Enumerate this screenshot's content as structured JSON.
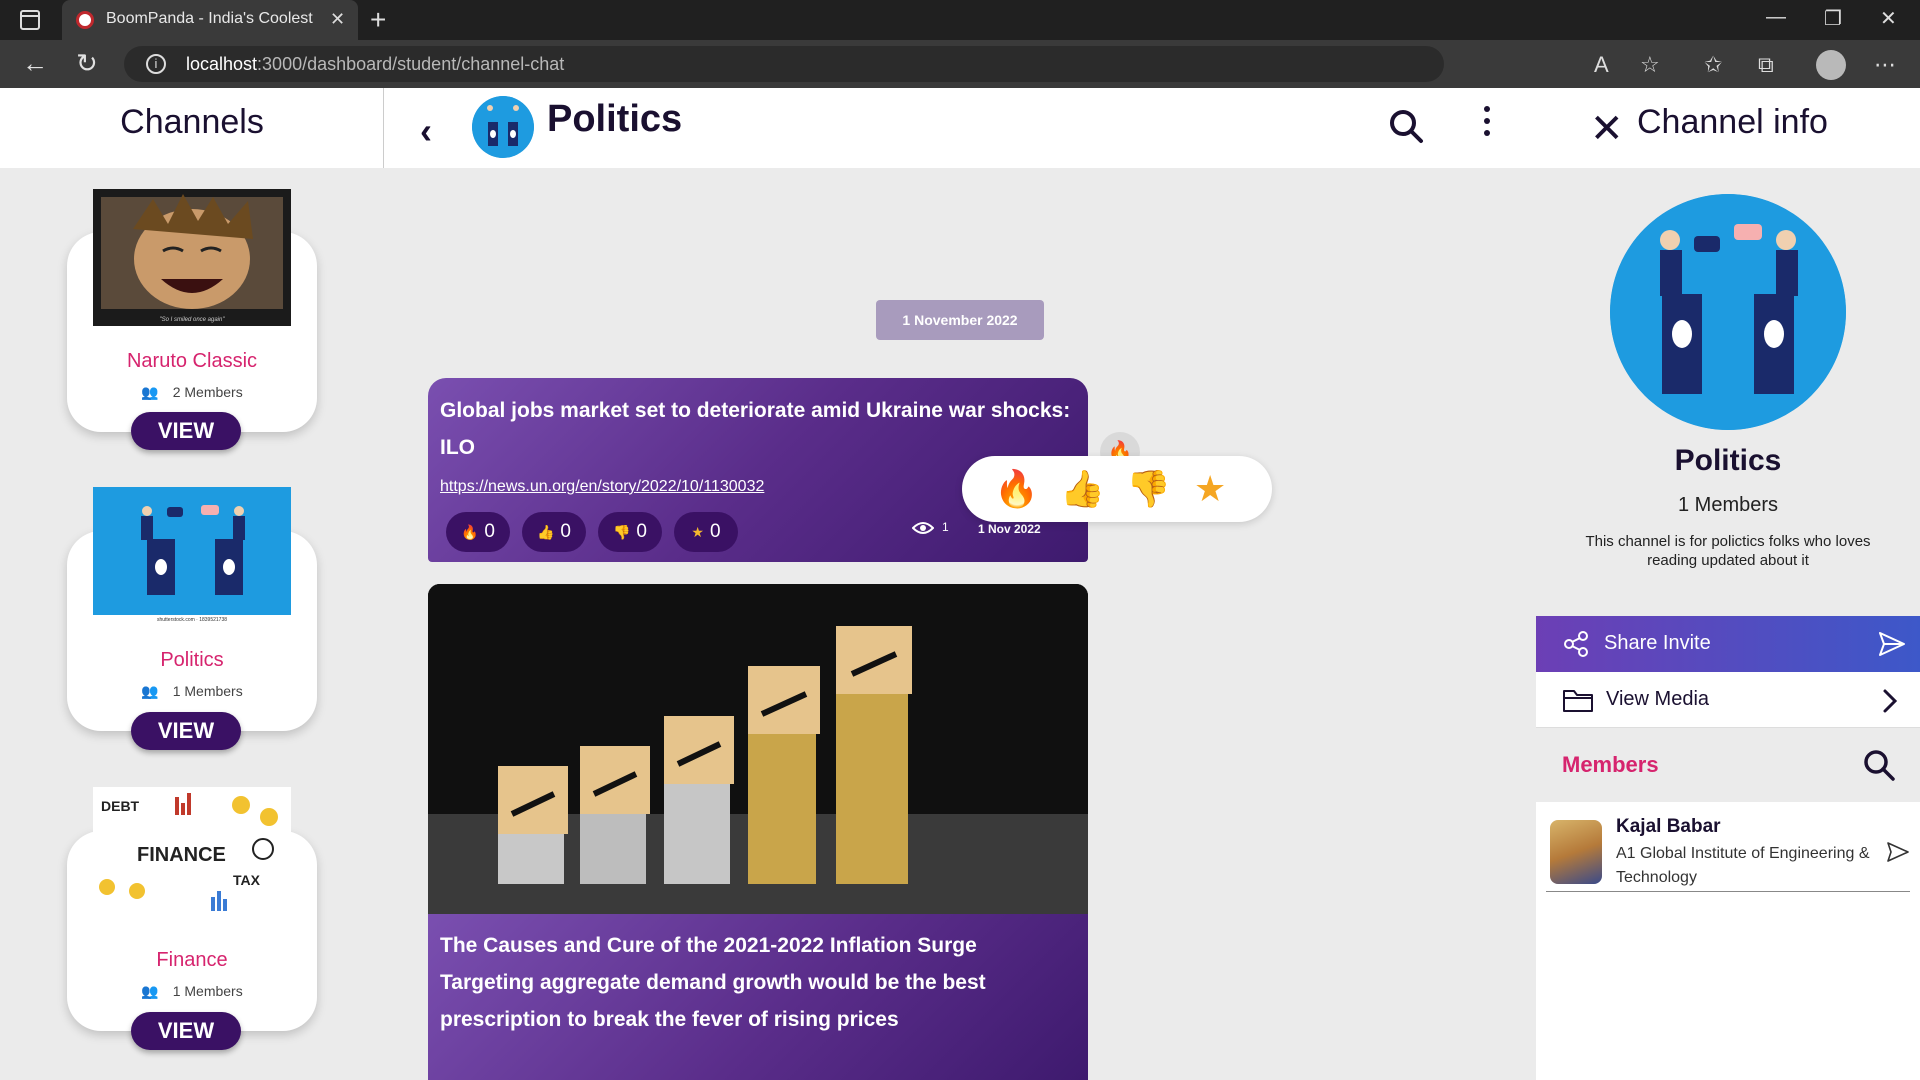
{
  "browser": {
    "tab_title": "BoomPanda - India's Coolest Stu",
    "url_host": "localhost",
    "url_path": ":3000/dashboard/student/channel-chat",
    "icons": [
      "sidebar-icon",
      "close-icon",
      "new-tab-icon",
      "minimize-icon",
      "maximize-icon",
      "window-close-icon",
      "back-icon",
      "refresh-icon",
      "info-icon",
      "read-aloud-icon",
      "add-favorite-icon",
      "favorites-icon",
      "collections-icon",
      "profile-icon",
      "more-icon"
    ]
  },
  "left_panel": {
    "title": "Channels",
    "channels": [
      {
        "name": "Naruto Classic",
        "members": "2 Members",
        "view_label": "VIEW",
        "caption": "\"So I smiled once again\""
      },
      {
        "name": "Politics",
        "members": "1 Members",
        "view_label": "VIEW",
        "caption": "shutterstock.com · 1839521738"
      },
      {
        "name": "Finance",
        "members": "1 Members",
        "view_label": "VIEW",
        "caption": "DEBT FINANCE TAX"
      }
    ]
  },
  "chat": {
    "title": "Politics",
    "date_divider": "1 November 2022",
    "message": {
      "text": "Global jobs market set to deteriorate amid Ukraine war shocks: ILO",
      "link": "https://news.un.org/en/story/2022/10/1130032",
      "reactions": [
        {
          "emoji": "🔥",
          "count": "0"
        },
        {
          "emoji": "👍",
          "count": "0"
        },
        {
          "emoji": "👎",
          "count": "0"
        },
        {
          "emoji": "★",
          "count": "0"
        }
      ],
      "views": "1",
      "date": "1 Nov 2022"
    },
    "reaction_picker": [
      "🔥",
      "👍",
      "👎",
      "★"
    ],
    "post": {
      "line1": "The Causes and Cure of the 2021-2022 Inflation Surge",
      "line2": "Targeting aggregate demand growth would be the best",
      "line3": "prescription to break the fever of rising prices"
    }
  },
  "right_panel": {
    "title": "Channel info",
    "channel_name": "Politics",
    "members_count": "1 Members",
    "description": "This channel is for polictics folks who loves reading updated about it",
    "share_label": "Share Invite",
    "media_label": "View Media",
    "members_label": "Members",
    "members": [
      {
        "name": "Kajal Babar",
        "institute": "A1 Global Institute of Engineering & Technology"
      }
    ],
    "colors": {
      "accent": "#d6246e",
      "dark": "#3a1164",
      "share_start": "#6c3fb5",
      "share_end": "#3d58c9"
    }
  }
}
